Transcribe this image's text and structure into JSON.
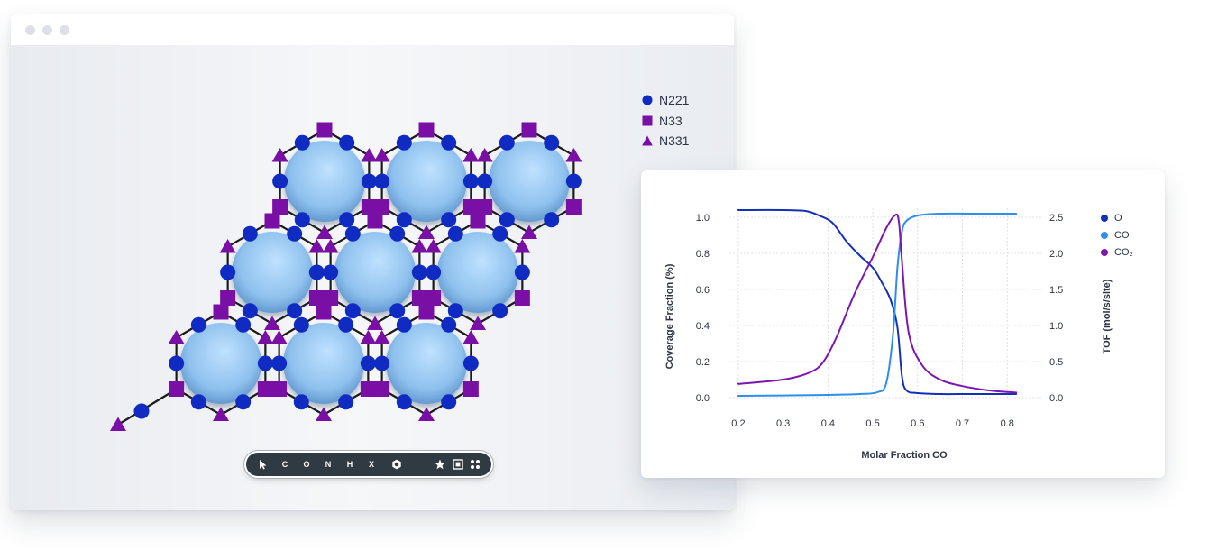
{
  "window": {
    "controls": [
      "close",
      "minimize",
      "maximize"
    ]
  },
  "lattice_legend": [
    {
      "label": "N221",
      "shape": "circle",
      "color": "#0f2bc2",
      "icon": "circle-icon"
    },
    {
      "label": "N33",
      "shape": "square",
      "color": "#7a0fa6",
      "icon": "square-icon"
    },
    {
      "label": "N331",
      "shape": "triangle",
      "color": "#7a0fa6",
      "icon": "triangle-icon"
    }
  ],
  "toolbar": {
    "items": [
      {
        "id": "pointer",
        "label": "",
        "icon": "pointer-icon"
      },
      {
        "id": "c",
        "label": "C",
        "icon": ""
      },
      {
        "id": "o",
        "label": "O",
        "icon": ""
      },
      {
        "id": "n",
        "label": "N",
        "icon": ""
      },
      {
        "id": "h",
        "label": "H",
        "icon": ""
      },
      {
        "id": "x",
        "label": "X",
        "icon": ""
      },
      {
        "id": "ring",
        "label": "",
        "icon": "hexagon-icon"
      },
      {
        "id": "star",
        "label": "",
        "icon": "star-icon"
      },
      {
        "id": "frame",
        "label": "",
        "icon": "frame-icon"
      },
      {
        "id": "grid",
        "label": "",
        "icon": "dots-grid-icon"
      }
    ]
  },
  "colors": {
    "node_blue": "#0f2bc2",
    "node_purple": "#7a0fa6",
    "bond": "#1b1b1b",
    "sphere_light": "#bfe2ff",
    "sphere_dark": "#5f95cc",
    "toolbar_bg": "#2f3a43",
    "series_o": "#1530b8",
    "series_co": "#2d8ef0",
    "series_co2": "#7d16b0"
  },
  "chart_data": {
    "type": "line",
    "title": "",
    "xlabel": "Molar Fraction CO",
    "ylabel_left": "Coverage Fraction (%)",
    "ylabel_right": "TOF (mol/s/site)",
    "xlim": [
      0.18,
      0.88
    ],
    "ylim_left": [
      0,
      1.05
    ],
    "ylim_right": [
      0,
      2.625
    ],
    "xticks": [
      0.2,
      0.3,
      0.4,
      0.5,
      0.6,
      0.7,
      0.8
    ],
    "xtick_labels": [
      "0.2",
      "0.3",
      "0.4",
      "0.5",
      "0.6",
      "0.7",
      "0.8"
    ],
    "yticks_left": [
      0.0,
      0.2,
      0.4,
      0.6,
      0.8,
      1.0
    ],
    "ytick_labels_left": [
      "0.0",
      "0.2",
      "0.4",
      "0.6",
      "0.8",
      "1.0"
    ],
    "yticks_right": [
      0.0,
      0.5,
      1.0,
      1.5,
      2.0,
      2.5
    ],
    "ytick_labels_right": [
      "0.0",
      "0.5",
      "1.0",
      "1.5",
      "2.0",
      "2.5"
    ],
    "grid": true,
    "legend_position": "right",
    "series": [
      {
        "name": "O",
        "axis": "left",
        "color": "#1530b8",
        "x": [
          0.2,
          0.3,
          0.35,
          0.38,
          0.41,
          0.44,
          0.47,
          0.5,
          0.52,
          0.54,
          0.555,
          0.565,
          0.575,
          0.6,
          0.65,
          0.72,
          0.82
        ],
        "y": [
          1.04,
          1.04,
          1.035,
          1.01,
          0.97,
          0.87,
          0.79,
          0.72,
          0.64,
          0.54,
          0.39,
          0.12,
          0.04,
          0.025,
          0.02,
          0.02,
          0.02
        ]
      },
      {
        "name": "CO",
        "axis": "left",
        "color": "#2d8ef0",
        "x": [
          0.2,
          0.3,
          0.4,
          0.47,
          0.51,
          0.53,
          0.545,
          0.555,
          0.565,
          0.575,
          0.6,
          0.65,
          0.72,
          0.82
        ],
        "y": [
          0.01,
          0.012,
          0.015,
          0.02,
          0.03,
          0.08,
          0.35,
          0.72,
          0.92,
          0.98,
          1.01,
          1.02,
          1.02,
          1.02
        ]
      },
      {
        "name": "CO₂",
        "axis": "right",
        "color": "#7d16b0",
        "x": [
          0.2,
          0.3,
          0.36,
          0.39,
          0.42,
          0.46,
          0.5,
          0.53,
          0.55,
          0.558,
          0.565,
          0.58,
          0.61,
          0.65,
          0.7,
          0.76,
          0.82
        ],
        "y": [
          0.19,
          0.25,
          0.35,
          0.5,
          0.85,
          1.45,
          1.95,
          2.35,
          2.53,
          2.45,
          1.9,
          0.9,
          0.45,
          0.25,
          0.16,
          0.1,
          0.07
        ]
      }
    ]
  }
}
